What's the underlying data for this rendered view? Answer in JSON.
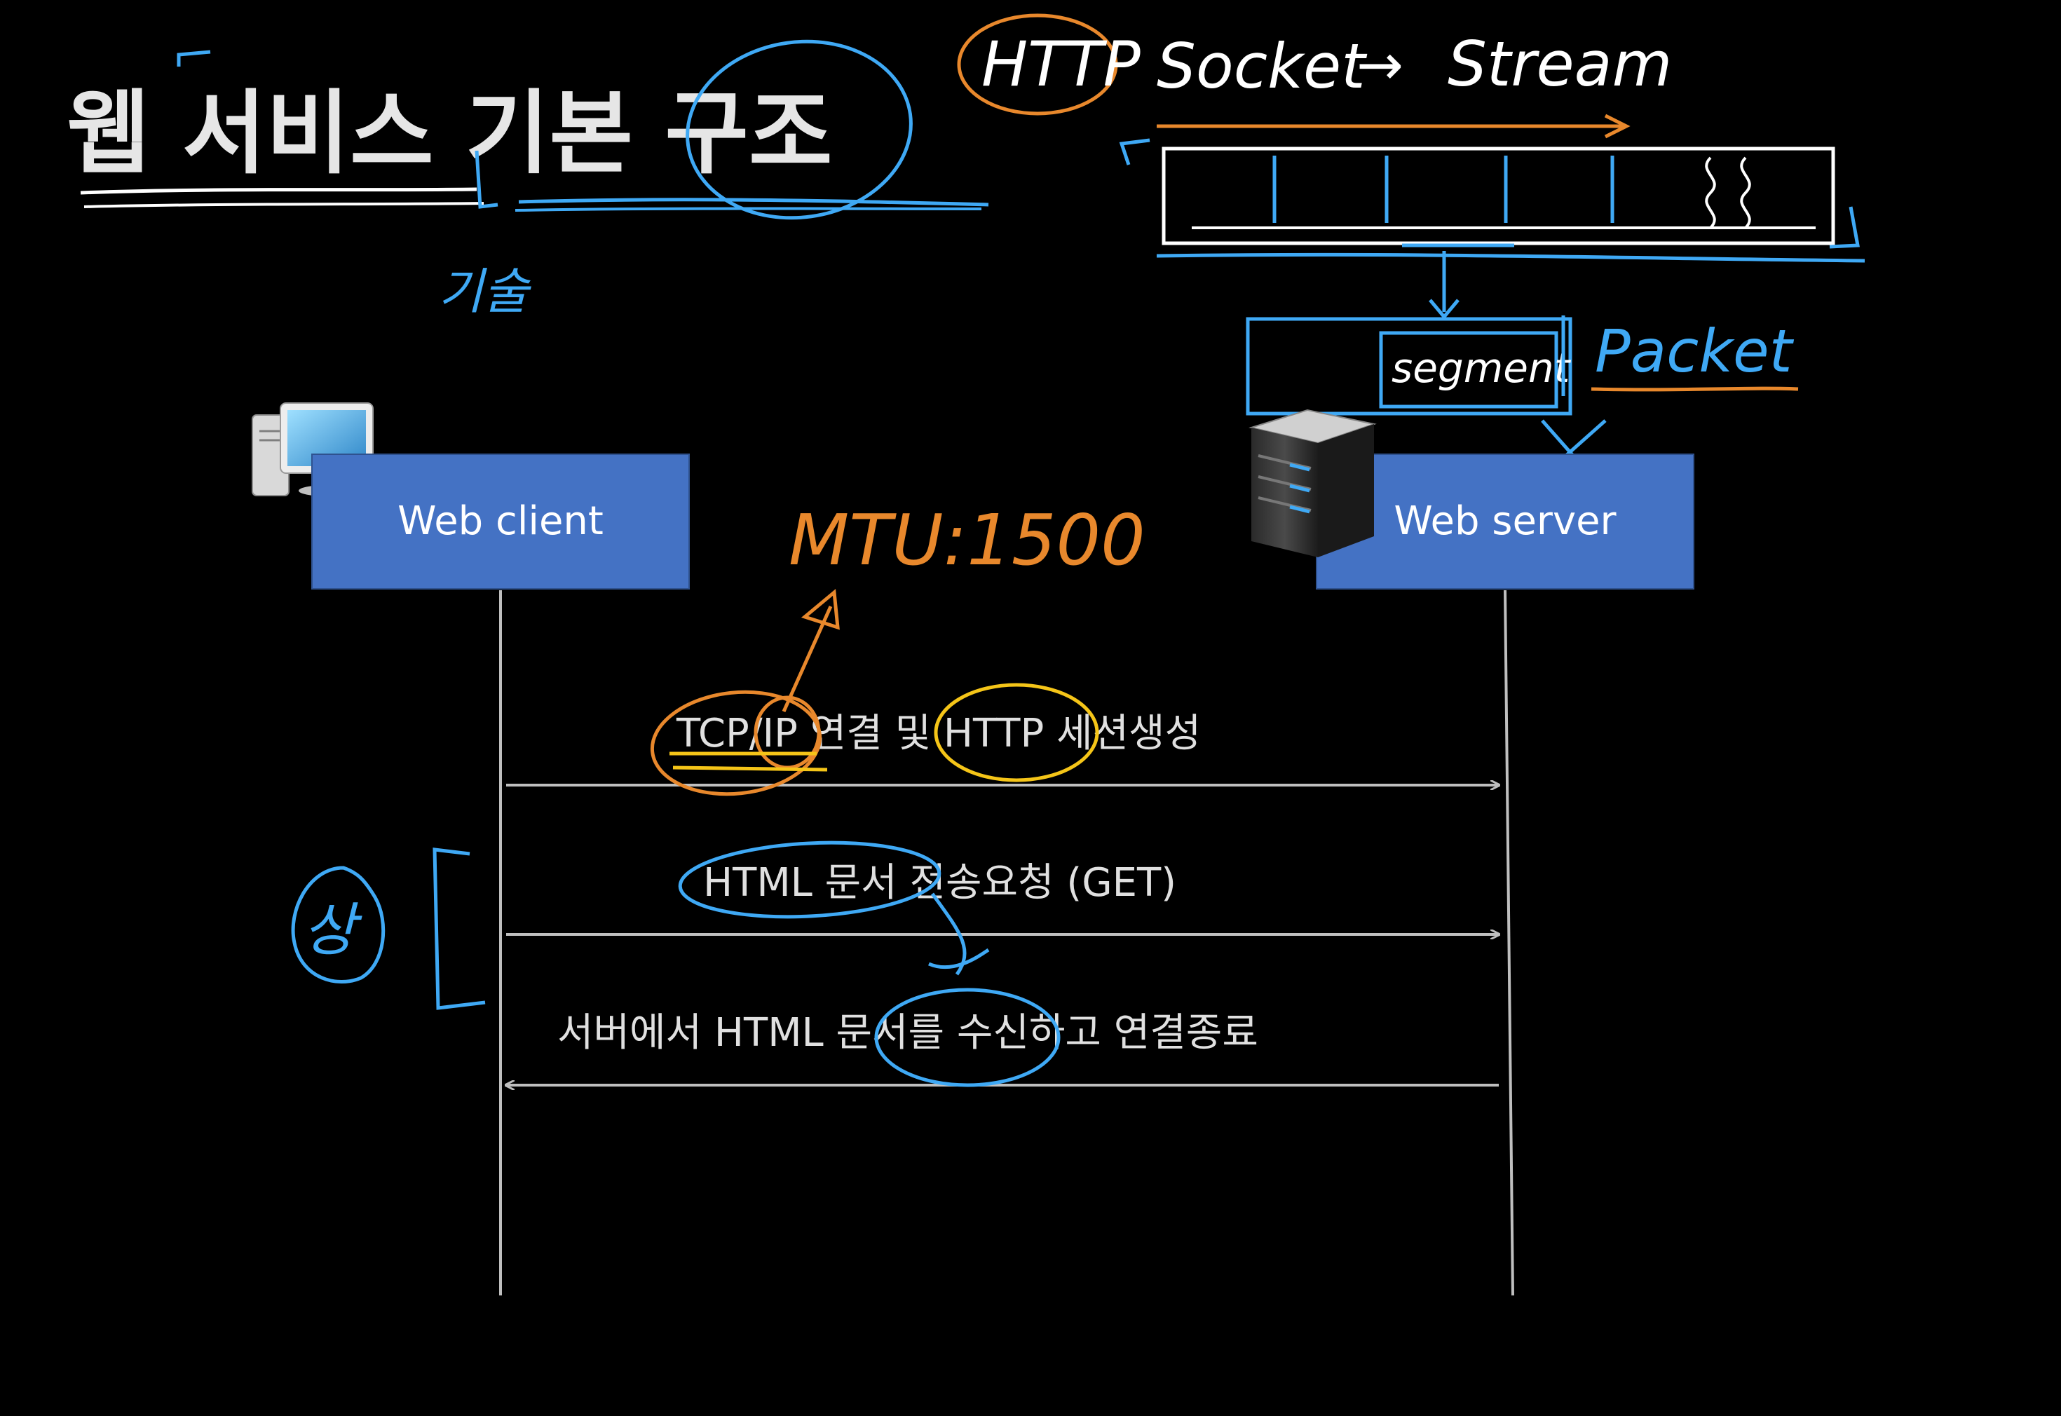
{
  "title": "웹 서비스 기본 구조",
  "annotations": {
    "gisul": "기술",
    "http_stack": {
      "http": "HTTP",
      "socket": "Socket",
      "arrow": "→",
      "stream": "Stream"
    },
    "segment": "segment",
    "packet": "Packet",
    "mtu": "MTU:1500",
    "sang": "상"
  },
  "nodes": {
    "client": {
      "label": "Web client",
      "icon": "desktop-computer-icon"
    },
    "server": {
      "label": "Web server",
      "icon": "server-rack-icon"
    }
  },
  "messages": [
    {
      "label": "TCP/IP 연결 및 HTTP 세션생성",
      "direction": "client-to-server"
    },
    {
      "label": "HTML 문서 전송요청 (GET)",
      "direction": "client-to-server"
    },
    {
      "label": "서버에서 HTML 문서를 수신하고 연결종료",
      "direction": "server-to-client"
    }
  ],
  "colors": {
    "background": "#000000",
    "box_fill": "#4472C4",
    "lifeline": "#BFBFBF",
    "ink_blue": "#3FA9F5",
    "ink_orange": "#E8882C",
    "ink_yellow": "#F5C518",
    "ink_white": "#FFFFFF"
  }
}
